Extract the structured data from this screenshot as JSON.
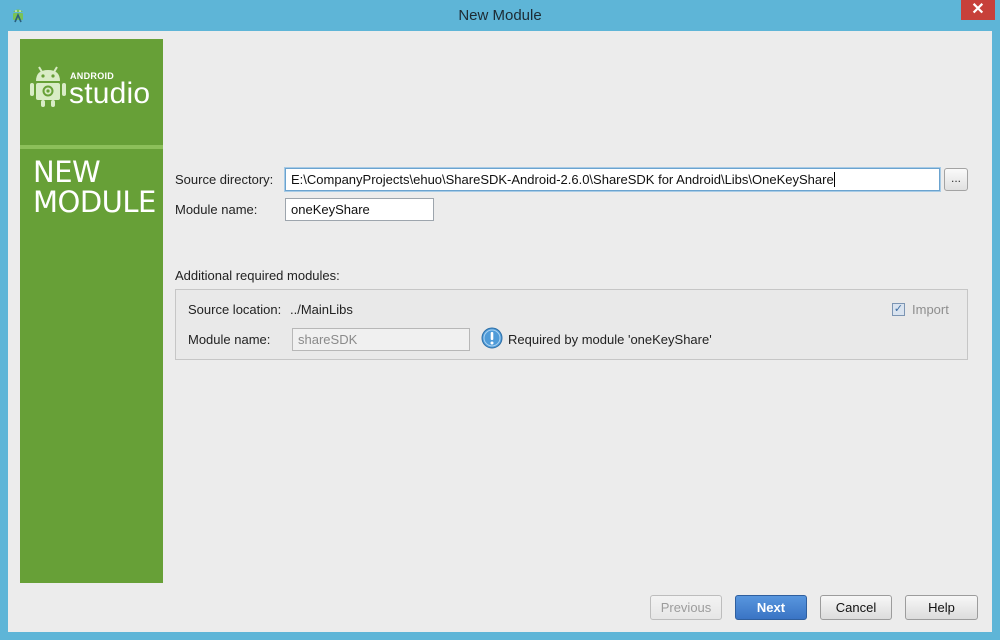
{
  "window": {
    "title": "New Module",
    "close_glyph": "✕"
  },
  "sidebar": {
    "logo_small": "ANDROID",
    "logo_big": "studio",
    "heading": "NEW MODULE",
    "colors": {
      "background": "#67a037",
      "separator": "#8cc05a"
    }
  },
  "form": {
    "source_directory_label": "Source directory:",
    "source_directory_value": "E:\\CompanyProjects\\ehuo\\ShareSDK-Android-2.6.0\\ShareSDK for Android\\Libs\\OneKeyShare",
    "browse_label": "...",
    "module_name_label": "Module name:",
    "module_name_value": "oneKeyShare"
  },
  "additional": {
    "heading": "Additional required modules:",
    "source_location_label": "Source location:",
    "source_location_value": "../MainLibs",
    "import_label": "Import",
    "import_checked": true,
    "module_name_label": "Module name:",
    "module_name_value": "shareSDK",
    "info_text": "Required by module 'oneKeyShare'"
  },
  "footer": {
    "previous": "Previous",
    "next": "Next",
    "cancel": "Cancel",
    "help": "Help"
  },
  "icons": {
    "app": "android-studio-icon",
    "logo": "android-robot-icon",
    "info": "info-icon",
    "check": "checkmark-icon"
  },
  "colors": {
    "frame": "#5eb5d7",
    "dialog": "#ececec",
    "accent": "#3a74c4",
    "close": "#c7403a"
  }
}
